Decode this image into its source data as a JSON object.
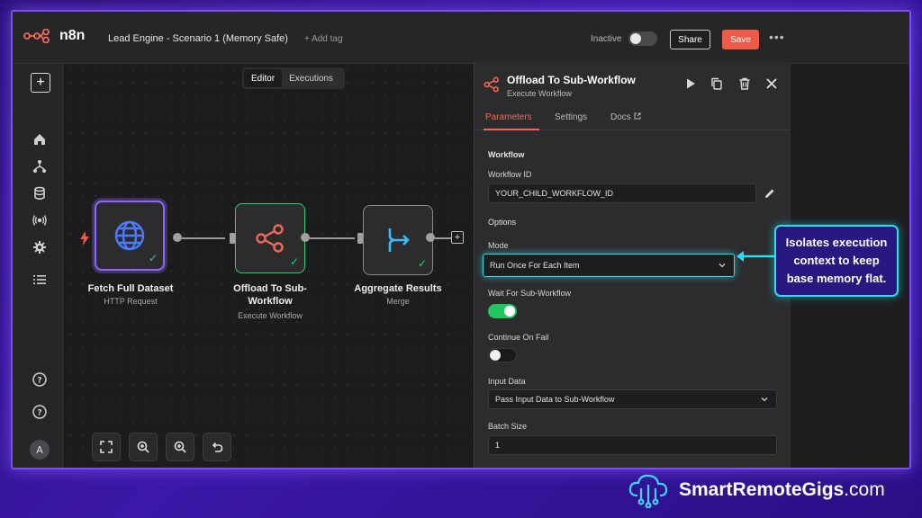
{
  "app": {
    "logo_text": "n8n",
    "workflow_title": "Lead Engine - Scenario 1 (Memory Safe)",
    "add_tag_label": "+ Add tag",
    "status_label": "Inactive",
    "share_label": "Share",
    "save_label": "Save",
    "save_color": "#ef5b48",
    "accent_color": "#ef6b56"
  },
  "canvas": {
    "view_tabs": [
      {
        "label": "Editor",
        "active": true
      },
      {
        "label": "Executions",
        "active": false
      }
    ],
    "nodes": [
      {
        "title": "Fetch Full Dataset",
        "subtitle": "HTTP Request",
        "icon": "globe-icon",
        "status": "success",
        "selected": true
      },
      {
        "title": "Offload To Sub-Workflow",
        "subtitle": "Execute Workflow",
        "icon": "share-icon",
        "status": "success",
        "selected": false
      },
      {
        "title": "Aggregate Results",
        "subtitle": "Merge",
        "icon": "merge-icon",
        "status": "success",
        "selected": false
      }
    ],
    "controls": [
      "fit-view-icon",
      "zoom-in-icon",
      "zoom-out-icon",
      "undo-icon"
    ]
  },
  "panel": {
    "title": "Offload To Sub-Workflow",
    "subtitle": "Execute Workflow",
    "tabs": [
      {
        "label": "Parameters",
        "active": true
      },
      {
        "label": "Settings",
        "active": false
      },
      {
        "label": "Docs",
        "active": false
      }
    ],
    "section_workflow": "Workflow",
    "workflow_id_label": "Workflow ID",
    "workflow_id_value": "YOUR_CHILD_WORKFLOW_ID",
    "options_label": "Options",
    "mode_label": "Mode",
    "mode_value": "Run Once For Each Item",
    "wait_label": "Wait For Sub-Workflow",
    "wait_on": true,
    "continue_label": "Continue On Fail",
    "continue_on": false,
    "input_data_label": "Input Data",
    "input_data_value": "Pass Input Data to Sub-Workflow",
    "batch_size_label": "Batch Size",
    "batch_size_value": "1"
  },
  "callout": {
    "text": "Isolates execution context to keep base memory flat.",
    "border_color": "#29e0f0"
  },
  "brand": {
    "name_bold": "SmartRemoteGigs",
    "name_suffix": ".com"
  }
}
